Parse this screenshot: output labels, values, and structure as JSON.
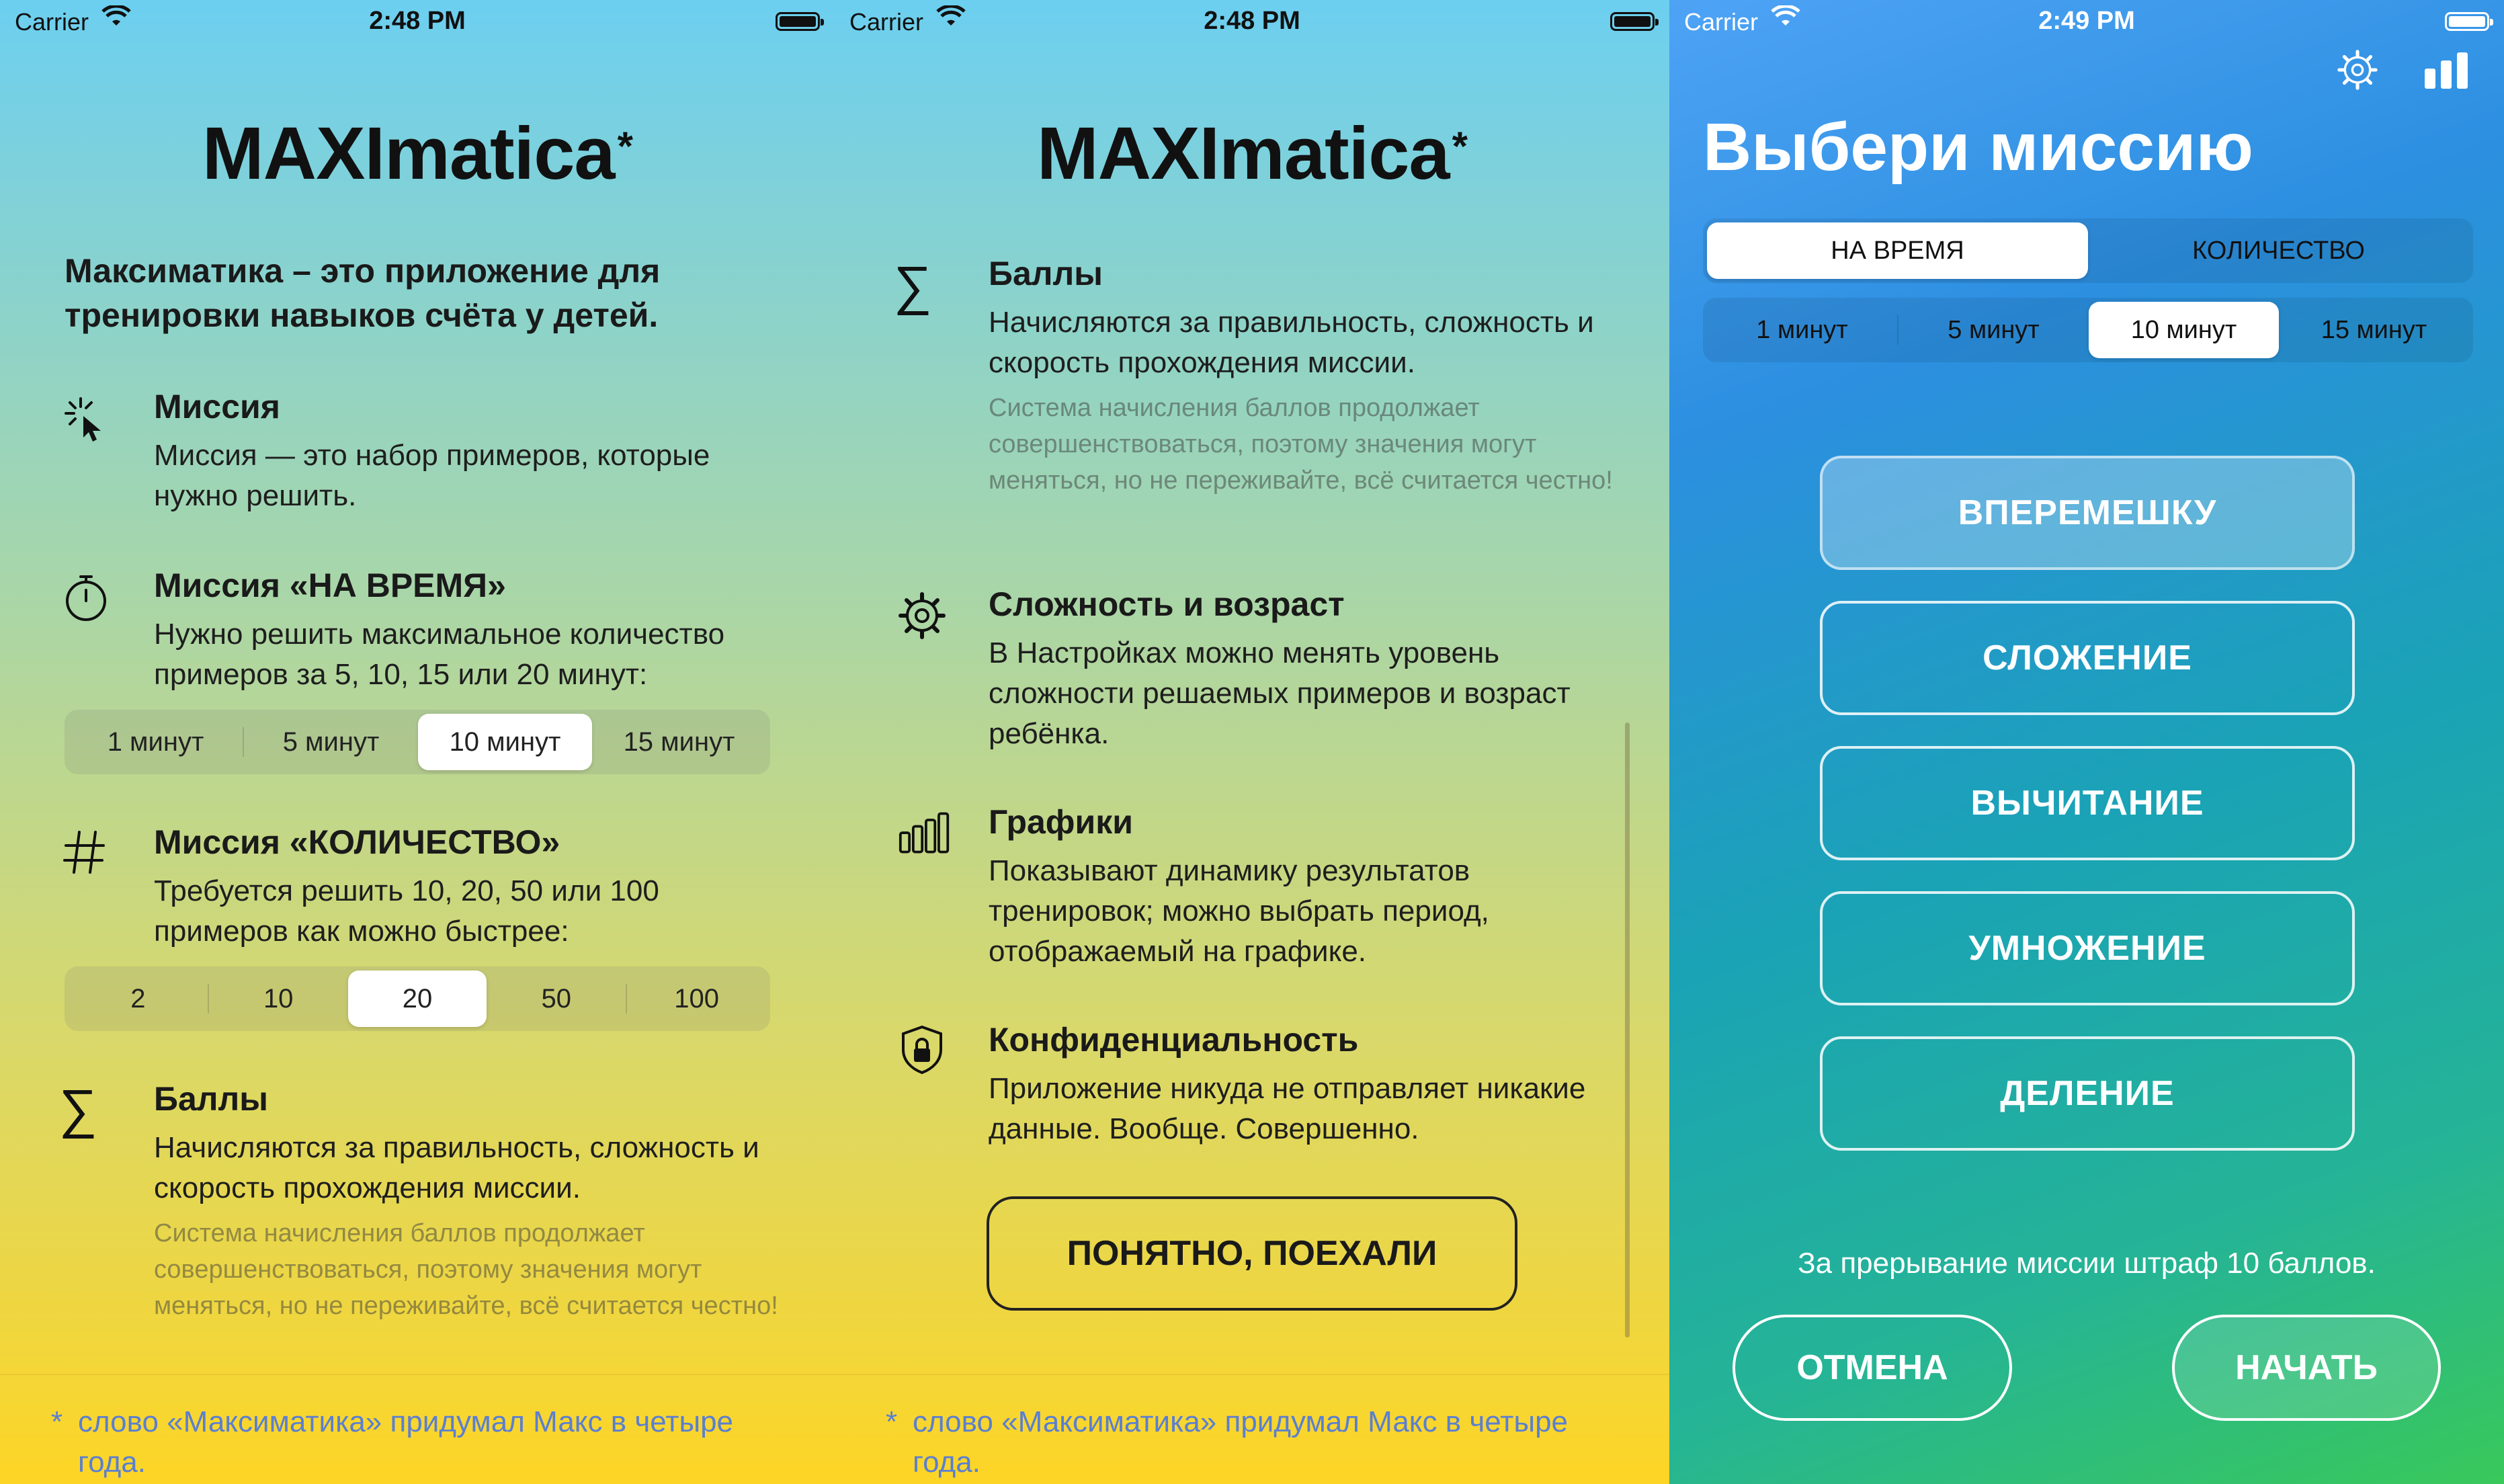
{
  "status": {
    "carrier": "Carrier",
    "time1": "2:48 PM",
    "time2": "2:48 PM",
    "time3": "2:49 PM"
  },
  "logo": {
    "name": "MAXImatica",
    "star": "*"
  },
  "intro": "Максиматика – это приложение для тренировки навыков счёта у детей.",
  "sections": {
    "mission": {
      "title": "Миссия",
      "body": "Миссия — это набор примеров, которые нужно решить."
    },
    "timed": {
      "title": "Миссия «НА ВРЕМЯ»",
      "body": "Нужно решить максимальное количество примеров за 5, 10, 15 или 20 минут:"
    },
    "count": {
      "title": "Миссия «КОЛИЧЕСТВО»",
      "body": "Требуется решить 10, 20, 50 или 100 примеров как можно быстрее:"
    },
    "points": {
      "title": "Баллы",
      "body": "Начисляются за правильность, сложность и скорость прохождения миссии.",
      "note": "Система начисления баллов продолжает совершенствоваться, поэтому значения могут меняться, но не переживайте, всё считается честно!"
    },
    "difficulty": {
      "title": "Сложность и возраст",
      "body": "В Настройках можно менять уровень сложности решаемых примеров и возраст ребёнка."
    },
    "charts": {
      "title": "Графики",
      "body": "Показывают динамику результатов тренировок; можно выбрать период, отображаемый на графике."
    },
    "privacy": {
      "title": "Конфиденциальность",
      "body": "Приложение никуда не отправляет никакие данные. Вообще. Совершенно."
    }
  },
  "time_segments": [
    "1 минут",
    "5 минут",
    "10 минут",
    "15 минут"
  ],
  "time_selected": "10 минут",
  "count_segments": [
    "2",
    "10",
    "20",
    "50",
    "100"
  ],
  "count_selected": "20",
  "footer": {
    "star": "*",
    "text": "слово «Максиматика» придумал Макс в четыре года."
  },
  "got_it_button": "ПОНЯТНО, ПОЕХАЛИ",
  "mission_screen": {
    "title": "Выбери миссию",
    "mode_tabs": [
      "НА ВРЕМЯ",
      "КОЛИЧЕСТВО"
    ],
    "mode_selected": "НА ВРЕМЯ",
    "operations": [
      "ВПЕРЕМЕШКУ",
      "СЛОЖЕНИЕ",
      "ВЫЧИТАНИЕ",
      "УМНОЖЕНИЕ",
      "ДЕЛЕНИЕ"
    ],
    "operation_active": "ВПЕРЕМЕШКУ",
    "penalty": "За прерывание миссии штраф 10 баллов.",
    "cancel": "ОТМЕНА",
    "start": "НАЧАТЬ"
  },
  "icons": {
    "gear": "gear-icon",
    "chart": "chart-icon",
    "sigma": "sigma-icon",
    "timer": "timer-icon",
    "hash": "hash-icon",
    "cursor": "cursor-icon",
    "shield": "shield-icon"
  }
}
